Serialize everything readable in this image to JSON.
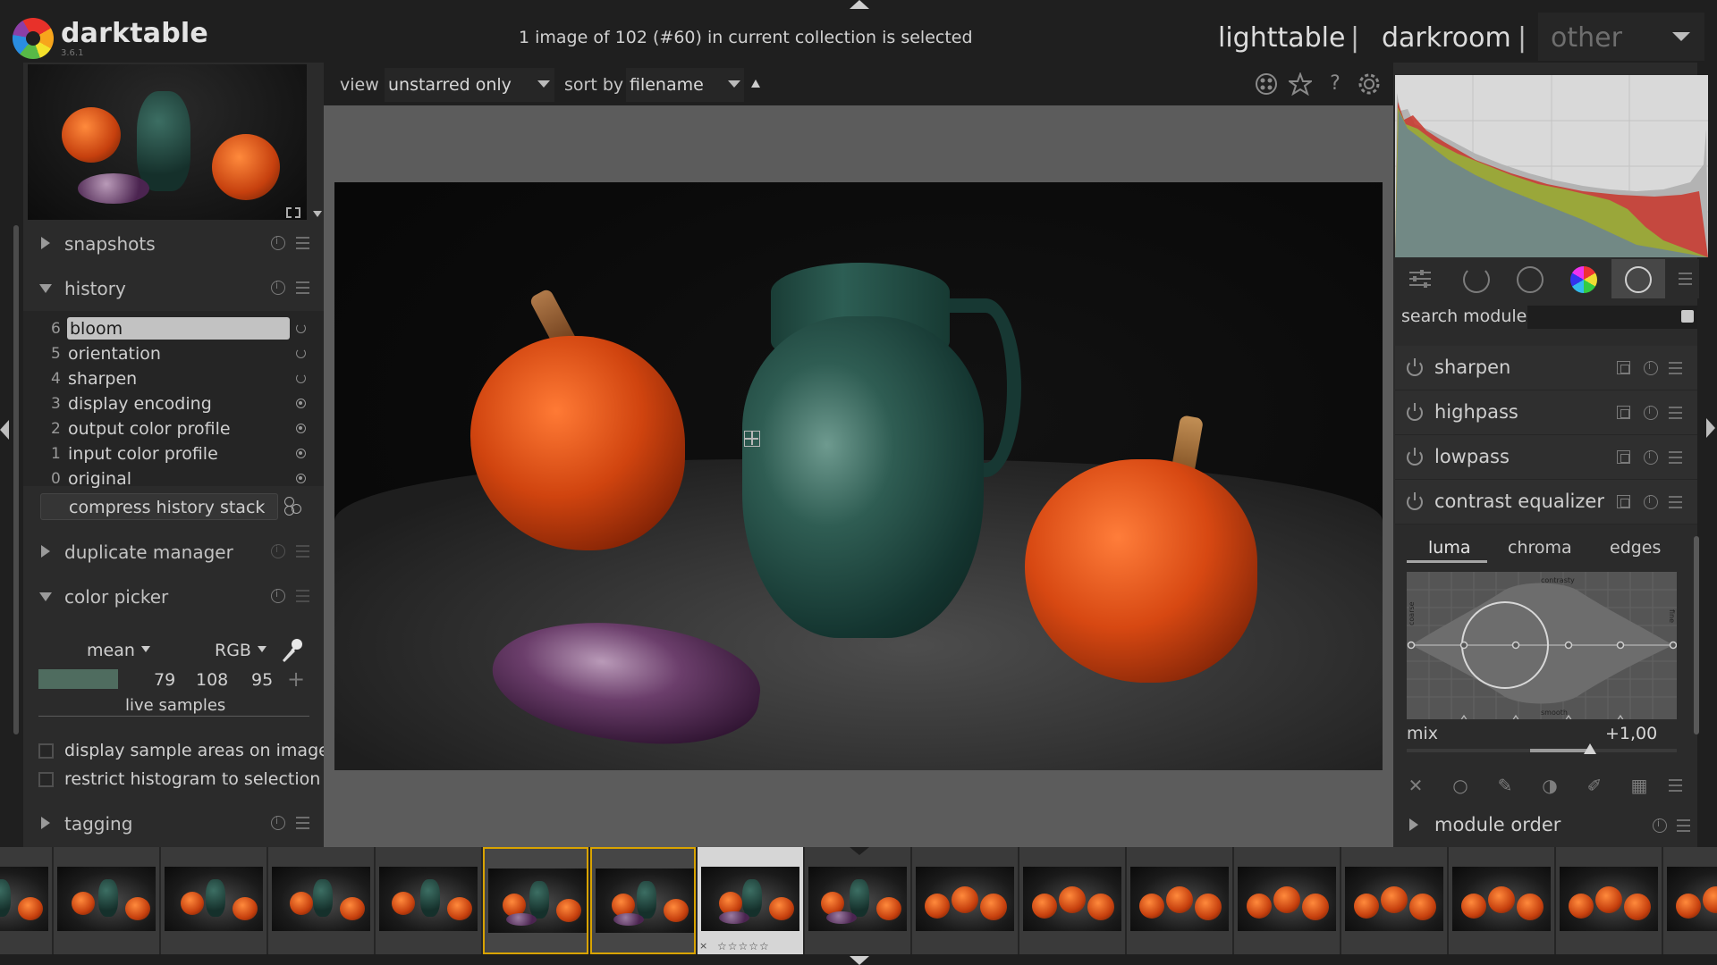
{
  "app": {
    "name": "darktable",
    "version": "3.6.1"
  },
  "status": "1 image of 102 (#60) in current collection is selected",
  "views": {
    "lighttable": "lighttable",
    "separator": "|",
    "darkroom": "darkroom",
    "other": "other"
  },
  "toolbar": {
    "view_label": "view",
    "view_value": "unstarred only",
    "sort_label": "sort by",
    "sort_value": "filename"
  },
  "left": {
    "snapshots": "snapshots",
    "history": {
      "title": "history",
      "items": [
        {
          "num": "6",
          "name": "bloom",
          "selected": true,
          "state": "power"
        },
        {
          "num": "5",
          "name": "orientation",
          "state": "power"
        },
        {
          "num": "4",
          "name": "sharpen",
          "state": "power"
        },
        {
          "num": "3",
          "name": "display encoding",
          "state": "always-on"
        },
        {
          "num": "2",
          "name": "output color profile",
          "state": "always-on"
        },
        {
          "num": "1",
          "name": "input color profile",
          "state": "always-on"
        },
        {
          "num": "0",
          "name": "original",
          "state": "always-on"
        }
      ],
      "compress": "compress history stack"
    },
    "duplicate_manager": "duplicate manager",
    "color_picker": {
      "title": "color picker",
      "mode": "mean",
      "space": "RGB",
      "swatch_color": "#4f6c5f",
      "r": "79",
      "g": "108",
      "b": "95",
      "live_samples": "live samples",
      "display_sample_areas": "display sample areas on image",
      "restrict_histogram": "restrict histogram to selection"
    },
    "tagging": "tagging"
  },
  "right": {
    "search_label": "search module",
    "modules": [
      {
        "name": "sharpen"
      },
      {
        "name": "highpass"
      },
      {
        "name": "lowpass"
      },
      {
        "name": "contrast equalizer"
      }
    ],
    "contrast_equalizer": {
      "tabs": [
        "luma",
        "chroma",
        "edges"
      ],
      "active_tab": "luma",
      "graph_labels": {
        "top": "contrasty",
        "bottom": "smooth",
        "left": "coarse",
        "right": "fine"
      },
      "mix_label": "mix",
      "mix_value": "+1,00"
    },
    "module_order": "module order"
  },
  "filmstrip": {
    "selected_indices": [
      5,
      6
    ],
    "current_index": 7,
    "stars": "☆☆☆☆☆",
    "reject": "×"
  },
  "colors": {
    "panel_bg": "#2b2b2b",
    "center_bg": "#5c5c5c",
    "selection_border": "#d9a300"
  }
}
